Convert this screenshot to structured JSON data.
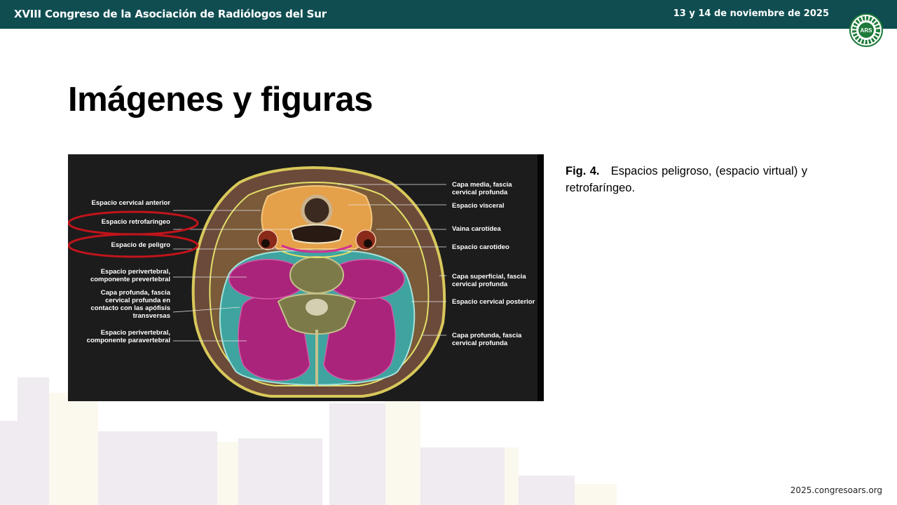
{
  "header": {
    "conference": "XVIII Congreso de la Asociación de Radiólogos del Sur",
    "date": "13 y 14 de noviembre de 2025",
    "logo_text": "ARS",
    "logo_ring_text": "ASOCIACIÓN RADIÓLOGOS SUR"
  },
  "slide": {
    "title": "Imágenes y figuras"
  },
  "figure": {
    "left_labels": [
      "Espacio cervical anterior",
      "Espacio retrofaríngeo",
      "Espacio de peligro",
      "Espacio perivertebral, componente prevertebral",
      "Capa profunda, fascia cervical profunda en contacto con las apófisis transversas",
      "Espacio perivertebral, componente paravertebral"
    ],
    "right_labels": [
      "Capa media, fascia cervical profunda",
      "Espacio visceral",
      "Vaina carotídea",
      "Espacio carotídeo",
      "Capa superficial, fascia cervical profunda",
      "Espacio cervical posterior",
      "Capa profunda, fascia cervical profunda"
    ]
  },
  "caption": {
    "fig_label": "Fig. 4.",
    "text": "Espacios peligroso, (espacio virtual) y retrofaríngeo."
  },
  "footer": {
    "url": "2025.congresoars.org"
  },
  "colors": {
    "header_bg": "#0f4d51",
    "highlight_circle": "#c0141b",
    "logo_green": "#1e7b3a"
  }
}
